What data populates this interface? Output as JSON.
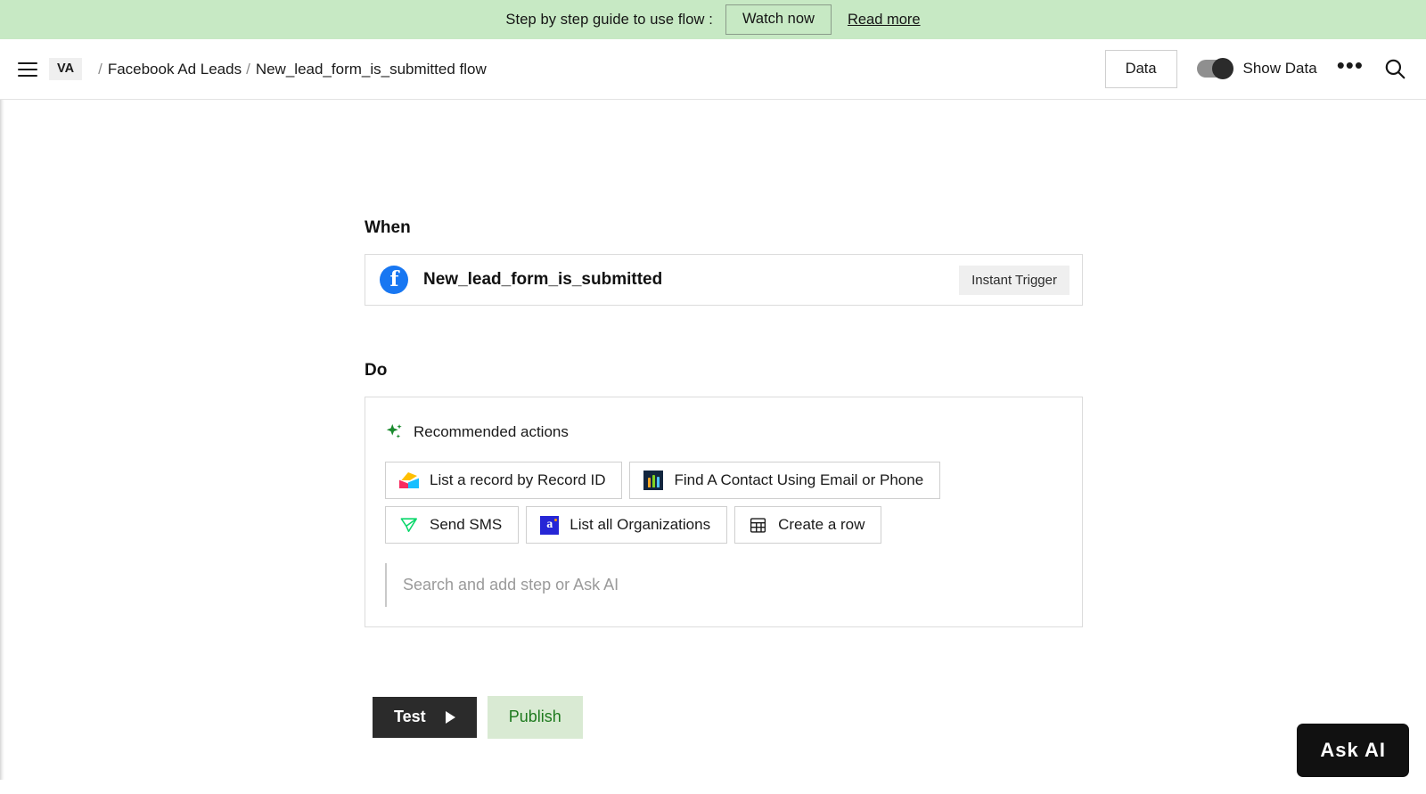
{
  "promo": {
    "text": "Step by step guide to use flow :",
    "watch_label": "Watch now",
    "read_label": "Read more",
    "background": "#c7e9c4"
  },
  "header": {
    "menu_icon": "hamburger-icon",
    "workspace_badge": "VA",
    "breadcrumb": {
      "separator": "/",
      "items": [
        "Facebook Ad Leads",
        "New_lead_form_is_submitted flow"
      ]
    },
    "data_button": "Data",
    "show_data_label": "Show Data",
    "show_data_on": true,
    "more_icon": "ellipsis-icon",
    "search_icon": "search-icon"
  },
  "flow": {
    "when": {
      "title": "When",
      "trigger_icon": "facebook-icon",
      "trigger_name": "New_lead_form_is_submitted",
      "trigger_badge": "Instant Trigger"
    },
    "do": {
      "title": "Do",
      "recommended_icon": "sparkle-icon",
      "recommended_label": "Recommended actions",
      "actions": [
        {
          "label": "List a record by Record ID",
          "icon": "airtable-icon"
        },
        {
          "label": "Find A Contact Using Email or Phone",
          "icon": "keap-icon"
        },
        {
          "label": "Send SMS",
          "icon": "send-sms-icon"
        },
        {
          "label": "List all Organizations",
          "icon": "accelo-icon"
        },
        {
          "label": "Create a row",
          "icon": "table-row-icon"
        }
      ],
      "search_placeholder": "Search and add step or Ask AI"
    }
  },
  "bottom": {
    "test_label": "Test",
    "test_icon": "play-icon",
    "publish_label": "Publish",
    "publish_color": "#1e7a1e"
  },
  "ask_ai": {
    "label": "Ask AI"
  }
}
